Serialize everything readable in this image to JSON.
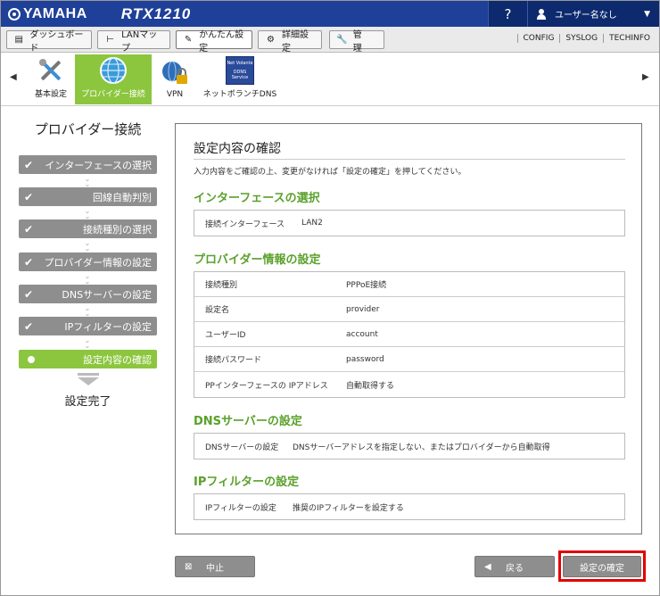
{
  "brand": {
    "logo": "YAMAHA",
    "model": "RTX1210"
  },
  "topbar": {
    "help": "?",
    "user": "ユーザー名なし",
    "chevron": "▼"
  },
  "tabs": [
    {
      "label": "ダッシュボード",
      "icon": "▤"
    },
    {
      "label": "LANマップ",
      "icon": "⊢"
    },
    {
      "label": "かんたん設定",
      "icon": "✎"
    },
    {
      "label": "詳細設定",
      "icon": "⚙"
    },
    {
      "label": "管　理",
      "icon": "🔧"
    }
  ],
  "right_links": [
    "CONFIG",
    "SYSLOG",
    "TECHINFO"
  ],
  "quick": {
    "left_arrow": "◀",
    "right_arrow": "▶",
    "items": [
      {
        "label": "基本設定"
      },
      {
        "label": "プロバイダー接続"
      },
      {
        "label": "VPN"
      },
      {
        "label": "ネットボランチDNS"
      }
    ],
    "ddns_text": "DDNS Service",
    "net_text": "Net Volante"
  },
  "sidebar": {
    "title": "プロバイダー接続",
    "steps": [
      {
        "label": "インターフェースの選択",
        "state": "done"
      },
      {
        "label": "回線自動判別",
        "state": "done"
      },
      {
        "label": "接続種別の選択",
        "state": "done"
      },
      {
        "label": "プロバイダー情報の設定",
        "state": "done"
      },
      {
        "label": "DNSサーバーの設定",
        "state": "done"
      },
      {
        "label": "IPフィルターの設定",
        "state": "done"
      },
      {
        "label": "設定内容の確認",
        "state": "current"
      }
    ],
    "check": "✔",
    "down_arrow": "⌄",
    "done_label": "設定完了"
  },
  "panel": {
    "title": "設定内容の確認",
    "description": "入力内容をご確認の上、変更がなければ「設定の確定」を押してください。",
    "sections": [
      {
        "heading": "インターフェースの選択",
        "rows": [
          {
            "key": "接続インターフェース",
            "value": "LAN2"
          }
        ]
      },
      {
        "heading": "プロバイダー情報の設定",
        "rows": [
          {
            "key": "接続種別",
            "value": "PPPoE接続"
          },
          {
            "key": "設定名",
            "value": "provider"
          },
          {
            "key": "ユーザーID",
            "value": "account"
          },
          {
            "key": "接続パスワード",
            "value": "password"
          },
          {
            "key": "PPインターフェースの IPアドレス",
            "value": "自動取得する"
          }
        ]
      },
      {
        "heading": "DNSサーバーの設定",
        "rows": [
          {
            "key": "DNSサーバーの設定",
            "value": "DNSサーバーアドレスを指定しない、またはプロバイダーから自動取得"
          }
        ]
      },
      {
        "heading": "IPフィルターの設定",
        "rows": [
          {
            "key": "IPフィルターの設定",
            "value": "推奨のIPフィルターを設定する"
          }
        ]
      }
    ]
  },
  "buttons": {
    "cancel": {
      "label": "中止",
      "icon": "⊠"
    },
    "back": {
      "label": "戻る",
      "icon": "◀"
    },
    "confirm": {
      "label": "設定の確定"
    }
  },
  "colors": {
    "header": "#1f4099",
    "accent_green": "#8cc63f",
    "section_green": "#5aa12b",
    "step_gray": "#8e8e8e",
    "highlight": "#e00000"
  }
}
